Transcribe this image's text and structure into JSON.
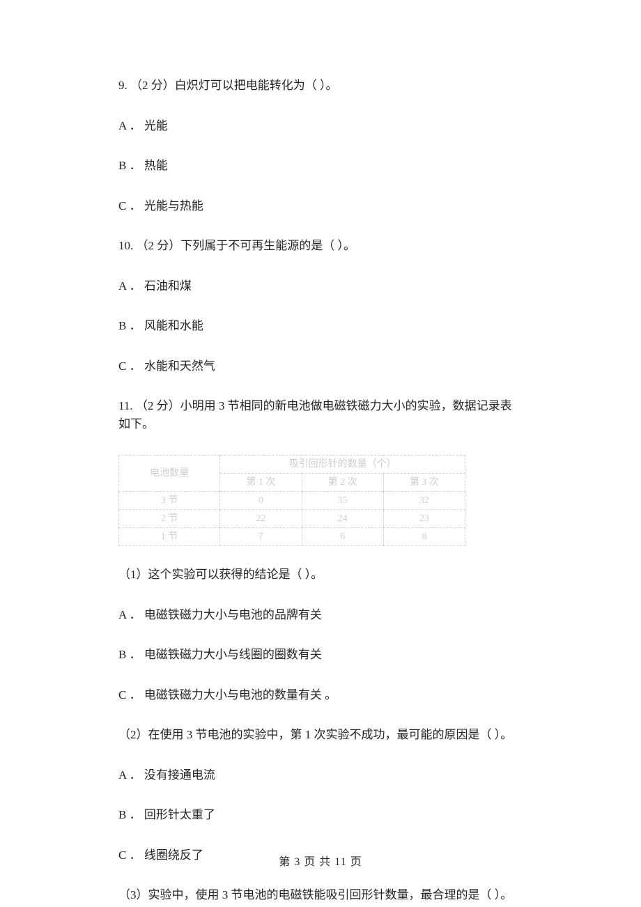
{
  "q9": {
    "stem": "9.  （2 分）白炽灯可以把电能转化为（        ）。",
    "optA": "A ．  光能",
    "optB": "B ．  热能",
    "optC": "C ．  光能与热能"
  },
  "q10": {
    "stem": "10.  （2 分）下列属于不可再生能源的是（        ）。",
    "optA": "A ．  石油和煤",
    "optB": "B ．  风能和水能",
    "optC": "C ．  水能和天然气"
  },
  "q11": {
    "stem": "11.  （2 分）小明用 3 节相同的新电池做电磁铁磁力大小的实验，数据记录表如下。",
    "table": {
      "header_left": "电池数量",
      "header_main": "吸引回形针的数量（个）",
      "sub1": "第 1 次",
      "sub2": "第 2 次",
      "sub3": "第 3 次",
      "r1c0": "3 节",
      "r1c1": "0",
      "r1c2": "35",
      "r1c3": "32",
      "r2c0": "2 节",
      "r2c1": "22",
      "r2c2": "24",
      "r2c3": "23",
      "r3c0": "1 节",
      "r3c1": "7",
      "r3c2": "6",
      "r3c3": "8"
    },
    "sub1": {
      "stem": "（1）这个实验可以获得的结论是（        ）。",
      "optA": "A ．  电磁铁磁力大小与电池的品牌有关",
      "optB": "B ．  电磁铁磁力大小与线圈的圈数有关",
      "optC": "C ．  电磁铁磁力大小与电池的数量有关  。"
    },
    "sub2": {
      "stem": "（2）在使用 3 节电池的实验中，第 1 次实验不成功，最可能的原因是（        ）。",
      "optA": "A ．  没有接通电流",
      "optB": "B ．  回形针太重了",
      "optC": "C ．  线圈绕反了"
    },
    "sub3": {
      "stem": "（3）实验中，使用 3 节电池的电磁铁能吸引回形针数量，最合理的是（        ）。"
    }
  },
  "footer": "第  3  页  共  11  页"
}
